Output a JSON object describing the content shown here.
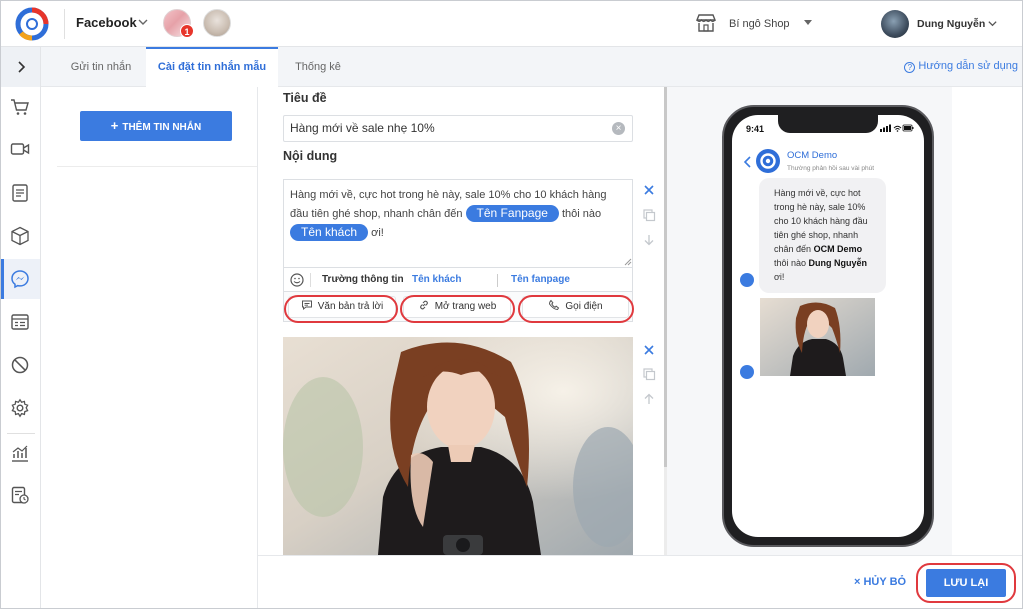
{
  "header": {
    "platform": "Facebook",
    "page_badge_count": "1",
    "shop_name": "Bí ngô Shop",
    "user_name": "Dung Nguyễn"
  },
  "sidebar": {
    "items": [
      "cart-icon",
      "video-icon",
      "document-icon",
      "box-icon",
      "messenger-icon",
      "form-icon",
      "block-icon",
      "settings-icon",
      "chart-icon",
      "report-icon"
    ],
    "active": "messenger-icon"
  },
  "tabs": [
    {
      "label": "Gửi tin nhắn"
    },
    {
      "label": "Cài đặt tin nhắn mẫu"
    },
    {
      "label": "Thống kê"
    }
  ],
  "help_link": "Hướng dẫn sử dụng",
  "list": {
    "add_button": "THÊM TIN NHẮN"
  },
  "editor": {
    "title_label": "Tiêu đề",
    "title_value": "Hàng mới về sale nhẹ 10%",
    "content_label": "Nội dung",
    "content_text_1": "Hàng mới về, cực hot trong hè này, sale 10% cho 10 khách hàng đầu tiên ghé shop, nhanh chân đến",
    "content_chip_page": "Tên Fanpage",
    "content_text_2": "thôi nào",
    "content_chip_customer": "Tên khách",
    "content_text_3": "ơi!",
    "field_label": "Trường thông tin",
    "field_customer": "Tên khách",
    "field_fanpage": "Tên fanpage",
    "btn_reply": "Văn bản trả lời",
    "btn_web": "Mở trang web",
    "btn_call": "Gọi điện"
  },
  "preview": {
    "time": "9:41",
    "bot_name": "OCM Demo",
    "bot_subtitle": "Thường phản hồi sau vài phút",
    "msg_1": "Hàng mới về, cực hot trong hè này, sale 10% cho 10 khách hàng đầu tiên ghé shop, nhanh chân đến",
    "msg_page": "OCM Demo",
    "msg_2": "thôi nào",
    "msg_customer": "Dung Nguyễn",
    "msg_3": "ơi!"
  },
  "footer": {
    "cancel": "HỦY BỎ",
    "save": "LƯU LẠI"
  },
  "colors": {
    "accent": "#3b7be0",
    "highlight_oval": "#e0393e"
  }
}
